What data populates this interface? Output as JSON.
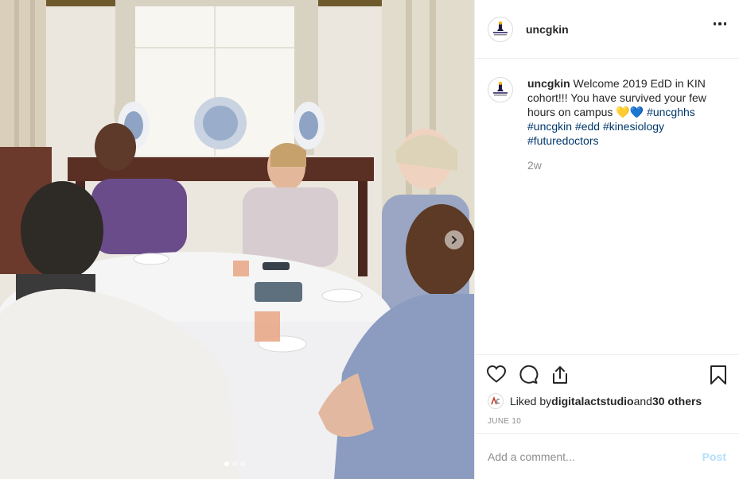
{
  "post": {
    "username": "uncgkin",
    "more_icon": "more-horizontal-icon",
    "caption": {
      "username": "uncgkin",
      "text": " Welcome 2019 EdD in KIN cohort!!! You have survived your few hours on campus ",
      "emoji_1": "💛",
      "emoji_2": "💙",
      "hashtags": [
        "#uncghhs",
        "#uncgkin",
        "#edd",
        "#kinesiology",
        "#futuredoctors"
      ]
    },
    "time_ago": "2w",
    "liked_by_prefix": "Liked by ",
    "liked_by_user": "digitalactstudio",
    "liked_by_and": " and ",
    "liked_by_others": "30 others",
    "date": "JUNE 10",
    "comment_placeholder": "Add a comment...",
    "post_label": "Post"
  },
  "carousel": {
    "total": 3,
    "active_index": 0,
    "next_icon": "chevron-right-icon"
  },
  "icons": {
    "like": "heart-icon",
    "comment": "comment-icon",
    "share": "share-icon",
    "save": "bookmark-icon"
  },
  "colors": {
    "link": "#00376b",
    "muted": "#8e8e8e",
    "post_disabled": "#b2dffc",
    "border": "#efefef"
  }
}
